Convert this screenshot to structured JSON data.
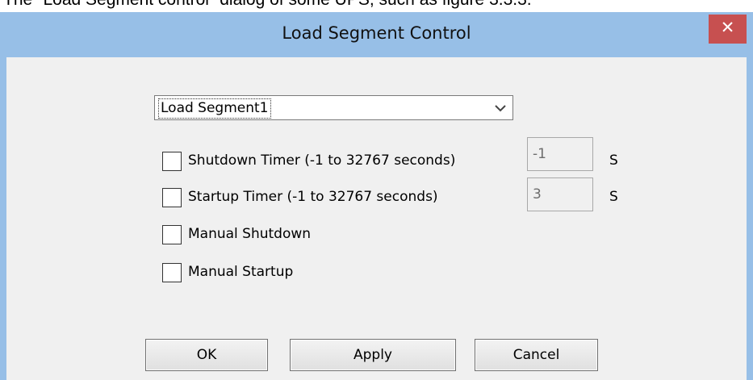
{
  "caption": "The \"Load Segment control\" dialog of some UPS, such as figure 3.3.3.",
  "window": {
    "title": "Load Segment Control",
    "close_glyph": "✕"
  },
  "segment_select": {
    "value": "Load Segment1"
  },
  "checkboxes": [
    {
      "label": "Shutdown Timer (-1 to 32767 seconds)",
      "checked": false
    },
    {
      "label": "Startup Timer (-1 to 32767 seconds)",
      "checked": false
    },
    {
      "label": "Manual Shutdown",
      "checked": false
    },
    {
      "label": "Manual Startup",
      "checked": false
    }
  ],
  "fields": {
    "shutdown_timer": {
      "value": "-1",
      "unit": "S"
    },
    "startup_timer": {
      "value": "3",
      "unit": "S"
    }
  },
  "buttons": {
    "ok": "OK",
    "apply": "Apply",
    "cancel": "Cancel"
  },
  "colors": {
    "frame": "#97bfe7",
    "close": "#c75050",
    "client": "#f0f0f0"
  }
}
